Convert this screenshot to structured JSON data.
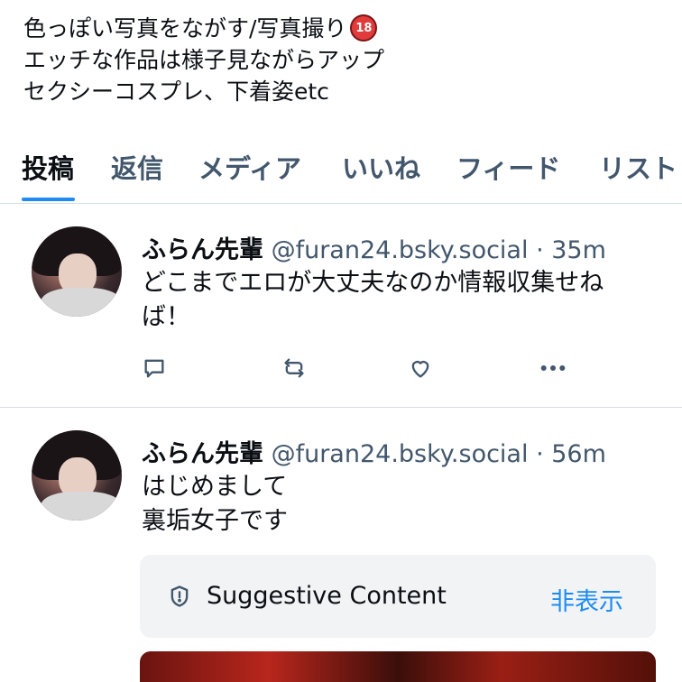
{
  "profile": {
    "bio_lines": [
      "色っぽい写真をながす/写真撮り",
      "エッチな作品は様子見ながらアップ",
      "セクシーコスプレ、下着姿etc"
    ],
    "bio_badge": "18"
  },
  "tabs": [
    {
      "label": "投稿",
      "active": true
    },
    {
      "label": "返信",
      "active": false
    },
    {
      "label": "メディア",
      "active": false
    },
    {
      "label": "いいね",
      "active": false
    },
    {
      "label": "フィード",
      "active": false
    },
    {
      "label": "リスト",
      "active": false
    }
  ],
  "posts": [
    {
      "author_name": "ふらん先輩",
      "handle": "@furan24.bsky.social",
      "time": "· 35m",
      "text": "どこまでエロが大丈夫なのか情報収集せねば！",
      "text_lines": [
        "どこまでエロが大丈夫なのか情報収集せね",
        "ば！"
      ],
      "actions": [
        "reply-icon",
        "repost-icon",
        "like-icon",
        "more-icon"
      ]
    },
    {
      "author_name": "ふらん先輩",
      "handle": "@furan24.bsky.social",
      "time": "· 56m",
      "text_lines": [
        "はじめまして",
        "裏垢女子です"
      ],
      "content_warning": {
        "label": "Suggestive Content",
        "action": "非表示",
        "icon": "shield-icon"
      }
    }
  ],
  "colors": {
    "accent": "#1d8cf2",
    "muted_text": "#42576c",
    "divider": "#d9dee3",
    "warning_bg": "#f1f3f5"
  }
}
